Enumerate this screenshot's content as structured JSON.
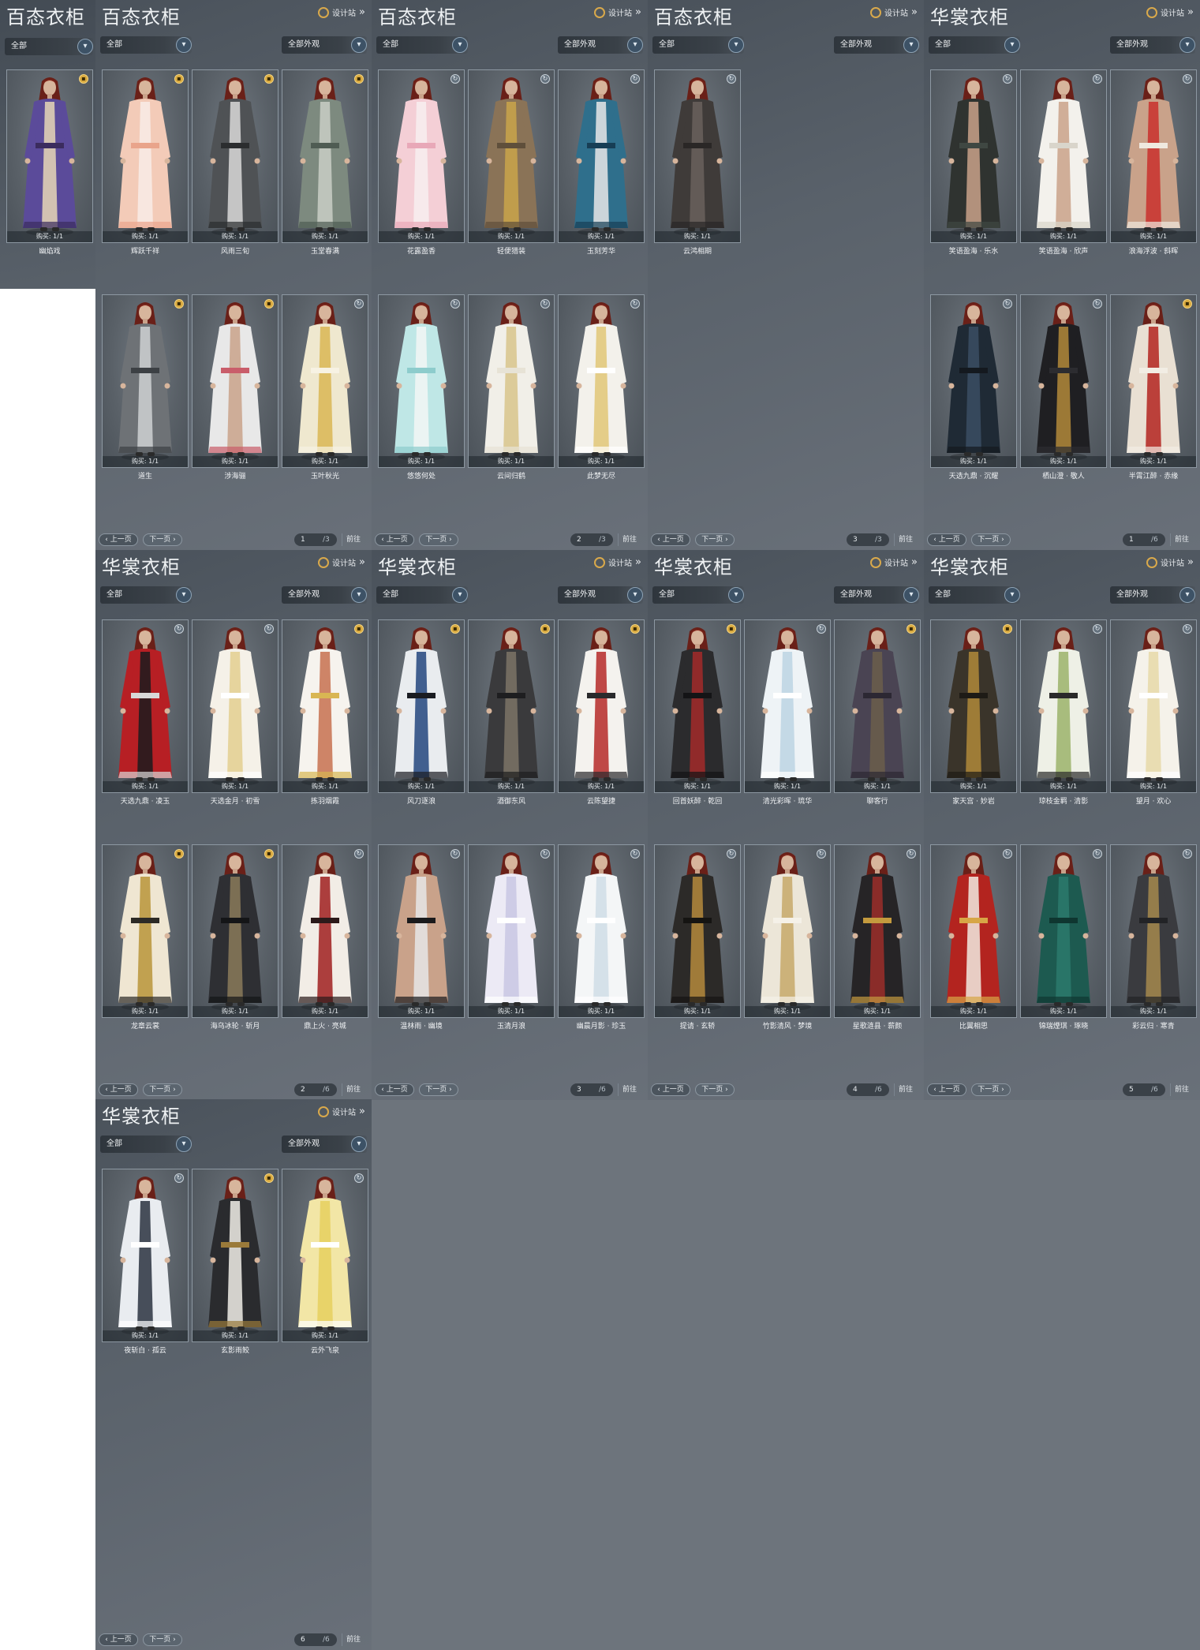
{
  "colors": {
    "panel_bg": "#59616a",
    "card_border": "#8d98a2",
    "badge_gold": "#d8a93f",
    "dropdown_chevron": "#3d5266"
  },
  "icons": {
    "designer": "designer-station-icon",
    "badge_gold": "gold-lock-icon",
    "badge_round": "refresh-icon",
    "chevron": "chevron-down-icon"
  },
  "panels": [
    {
      "title": "百态衣柜",
      "mini": true,
      "filter": "全部",
      "items": [
        {
          "name": "幽焰戏",
          "buy": "购买: 1/1",
          "badge": "gold",
          "skin": [
            "#5b4b9a",
            "#e7d7b6",
            "#3b2c5e"
          ]
        }
      ]
    },
    {
      "title": "百态衣柜",
      "designer": "设计站",
      "filter": "全部",
      "appearance": "全部外观",
      "items": [
        {
          "name": "辉跃千祥",
          "buy": "购买: 1/1",
          "badge": "gold",
          "skin": [
            "#f3cbb8",
            "#f8ece6",
            "#e9a48b"
          ]
        },
        {
          "name": "风雨三旬",
          "buy": "购买: 1/1",
          "badge": "gold",
          "skin": [
            "#4f5255",
            "#d9d9d9",
            "#2b2d2f"
          ]
        },
        {
          "name": "玉堂春满",
          "buy": "购买: 1/1",
          "badge": "gold",
          "skin": [
            "#7d8a7f",
            "#c9cec5",
            "#4f5c53"
          ]
        },
        {
          "name": "道生",
          "buy": "购买: 1/1",
          "badge": "gold",
          "skin": [
            "#6e7276",
            "#cfd1d3",
            "#3c4044"
          ]
        },
        {
          "name": "涉海骊",
          "buy": "购买: 1/1",
          "badge": "gold",
          "skin": [
            "#e8e8e8",
            "#c9a28a",
            "#c95d6a"
          ]
        },
        {
          "name": "玉叶秋光",
          "buy": "购买: 1/1",
          "badge": "round",
          "skin": [
            "#efe8cf",
            "#d9b653",
            "#f7f2e3"
          ]
        }
      ],
      "pager": {
        "prev": "上一页",
        "next": "下一页",
        "page": "1",
        "total": "/3",
        "jump": "前往"
      }
    },
    {
      "title": "百态衣柜",
      "designer": "设计站",
      "filter": "全部",
      "appearance": "全部外观",
      "items": [
        {
          "name": "花露盈香",
          "buy": "购买: 1/1",
          "badge": "round",
          "skin": [
            "#f4cfd6",
            "#f7eef0",
            "#e8a8b8"
          ]
        },
        {
          "name": "轻便猎装",
          "buy": "购买: 1/1",
          "badge": "round",
          "skin": [
            "#8a7357",
            "#c9a54a",
            "#5f4f3b"
          ]
        },
        {
          "name": "玉刻芳华",
          "buy": "购买: 1/1",
          "badge": "round",
          "skin": [
            "#2f6f8c",
            "#e7e7e7",
            "#173e55"
          ]
        },
        {
          "name": "悠悠何处",
          "buy": "购买: 1/1",
          "badge": "round",
          "skin": [
            "#bfe7e6",
            "#f2f6f5",
            "#8dcccc"
          ]
        },
        {
          "name": "云间归鹤",
          "buy": "购买: 1/1",
          "badge": "round",
          "skin": [
            "#f1efe8",
            "#d8c48b",
            "#e7e3d6"
          ]
        },
        {
          "name": "此梦无尽",
          "buy": "购买: 1/1",
          "badge": "round",
          "skin": [
            "#f3f1eb",
            "#e0c777",
            "#ffffff"
          ]
        }
      ],
      "pager": {
        "prev": "上一页",
        "next": "下一页",
        "page": "2",
        "total": "/3",
        "jump": "前往"
      }
    },
    {
      "title": "百态衣柜",
      "designer": "设计站",
      "filter": "全部",
      "appearance": "全部外观",
      "items": [
        {
          "name": "云鸿相期",
          "buy": "购买: 1/1",
          "badge": "round",
          "skin": [
            "#3f3b39",
            "#6a625d",
            "#2a2726"
          ]
        }
      ],
      "pager": {
        "prev": "上一页",
        "next": "下一页",
        "page": "3",
        "total": "/3",
        "jump": "前往"
      }
    },
    {
      "title": "华裳衣柜",
      "designer": "设计站",
      "filter": "全部",
      "appearance": "全部外观",
      "items": [
        {
          "name": "笑语盈海 · 乐水",
          "buy": "购买: 1/1",
          "badge": "round",
          "skin": [
            "#2f3330",
            "#c9a28a",
            "#3f4742"
          ]
        },
        {
          "name": "笑语盈海 · 欣声",
          "buy": "购买: 1/1",
          "badge": "round",
          "skin": [
            "#f3f1ec",
            "#c9a28a",
            "#d9d5cb"
          ]
        },
        {
          "name": "浪海浮波 · 斜晖",
          "buy": "购买: 1/1",
          "badge": "round",
          "skin": [
            "#c9a28a",
            "#c9302c",
            "#efe9df"
          ]
        },
        {
          "name": "天选九鼎 · 沉耀",
          "buy": "购买: 1/1",
          "badge": "round",
          "skin": [
            "#1f2a35",
            "#3b4e63",
            "#14191f"
          ]
        },
        {
          "name": "栖山澄 · 敬人",
          "buy": "购买: 1/1",
          "badge": "round",
          "skin": [
            "#1f1f22",
            "#b38a3a",
            "#2c2c30"
          ]
        },
        {
          "name": "半霄江醉 · 赤缘",
          "buy": "购买: 1/1",
          "badge": "gold",
          "skin": [
            "#e9e0d3",
            "#b3231f",
            "#f2ede4"
          ]
        }
      ],
      "pager": {
        "prev": "上一页",
        "next": "下一页",
        "page": "1",
        "total": "/6",
        "jump": "前往"
      }
    },
    {
      "title": "华裳衣柜",
      "designer": "设计站",
      "filter": "全部",
      "appearance": "全部外观",
      "items": [
        {
          "name": "天选九鼎 · 凌玉",
          "buy": "购买: 1/1",
          "badge": "round",
          "skin": [
            "#b71f24",
            "#1b1b1d",
            "#d8d8d8"
          ]
        },
        {
          "name": "天选金月 · 初雪",
          "buy": "购买: 1/1",
          "badge": "round",
          "skin": [
            "#f5f1e8",
            "#e3cf8f",
            "#ffffff"
          ]
        },
        {
          "name": "拣羽烟霞",
          "buy": "购买: 1/1",
          "badge": "gold",
          "skin": [
            "#f6f3ee",
            "#c7704f",
            "#d9b653"
          ]
        },
        {
          "name": "龙章云裳",
          "buy": "购买: 1/1",
          "badge": "gold",
          "skin": [
            "#efe6d2",
            "#b99439",
            "#2c2a26"
          ]
        },
        {
          "name": "海乌冰轮 · 斩月",
          "buy": "购买: 1/1",
          "badge": "gold",
          "skin": [
            "#2e2f33",
            "#8a7a5a",
            "#141517"
          ]
        },
        {
          "name": "鼎上火 · 亮城",
          "buy": "购买: 1/1",
          "badge": "round",
          "skin": [
            "#f2ede6",
            "#a01f1f",
            "#2b1a1a"
          ]
        }
      ],
      "pager": {
        "prev": "上一页",
        "next": "下一页",
        "page": "2",
        "total": "/6",
        "jump": "前往"
      }
    },
    {
      "title": "华裳衣柜",
      "designer": "设计站",
      "filter": "全部",
      "appearance": "全部外观",
      "items": [
        {
          "name": "风刀逐浪",
          "buy": "购买: 1/1",
          "badge": "gold",
          "skin": [
            "#e9ecef",
            "#23477e",
            "#1a1c22"
          ]
        },
        {
          "name": "酒御东风",
          "buy": "购买: 1/1",
          "badge": "gold",
          "skin": [
            "#3a3a3c",
            "#7c7466",
            "#1e1e20"
          ]
        },
        {
          "name": "云陈望捷",
          "buy": "购买: 1/1",
          "badge": "gold",
          "skin": [
            "#f4f2ee",
            "#b52a28",
            "#2a2a2c"
          ]
        },
        {
          "name": "温林雨 · 幽境",
          "buy": "购买: 1/1",
          "badge": "round",
          "skin": [
            "#c9a28a",
            "#e6e6e6",
            "#1a1a1c"
          ]
        },
        {
          "name": "玉清月浪",
          "buy": "购买: 1/1",
          "badge": "round",
          "skin": [
            "#eceaf5",
            "#c9c7e3",
            "#ffffff"
          ]
        },
        {
          "name": "幽晨月影 · 珍玉",
          "buy": "购买: 1/1",
          "badge": "round",
          "skin": [
            "#f4f6f7",
            "#cfdde6",
            "#ffffff"
          ]
        }
      ],
      "pager": {
        "prev": "上一页",
        "next": "下一页",
        "page": "3",
        "total": "/6",
        "jump": "前往"
      }
    },
    {
      "title": "华裳衣柜",
      "designer": "设计站",
      "filter": "全部",
      "appearance": "全部外观",
      "items": [
        {
          "name": "回首妖醉 · 乾回",
          "buy": "购买: 1/1",
          "badge": "gold",
          "skin": [
            "#2b2b2d",
            "#a32a2a",
            "#141416"
          ]
        },
        {
          "name": "清光彩晖 · 琉华",
          "buy": "购买: 1/1",
          "badge": "round",
          "skin": [
            "#eef3f6",
            "#bcd4e3",
            "#ffffff"
          ]
        },
        {
          "name": "聊客行",
          "buy": "购买: 1/1",
          "badge": "gold",
          "skin": [
            "#4a4453",
            "#6b5e4b",
            "#2c2833"
          ]
        },
        {
          "name": "提请 · 玄轿",
          "buy": "购买: 1/1",
          "badge": "round",
          "skin": [
            "#2c2a28",
            "#b58a3c",
            "#151412"
          ]
        },
        {
          "name": "竹影清风 · 梦境",
          "buy": "购买: 1/1",
          "badge": "round",
          "skin": [
            "#ece6d8",
            "#c7a86a",
            "#f5f1e8"
          ]
        },
        {
          "name": "星歌涟县 · 薪颜",
          "buy": "购买: 1/1",
          "badge": "round",
          "skin": [
            "#262426",
            "#9c2e2a",
            "#c49a3e"
          ]
        }
      ],
      "pager": {
        "prev": "上一页",
        "next": "下一页",
        "page": "4",
        "total": "/6",
        "jump": "前往"
      }
    },
    {
      "title": "华裳衣柜",
      "designer": "设计站",
      "filter": "全部",
      "appearance": "全部外观",
      "items": [
        {
          "name": "家天宫 · 妙岩",
          "buy": "购买: 1/1",
          "badge": "gold",
          "skin": [
            "#3a342a",
            "#b08a3a",
            "#1e1b16"
          ]
        },
        {
          "name": "琼枝金羁 · 清影",
          "buy": "购买: 1/1",
          "badge": "round",
          "skin": [
            "#eef0e6",
            "#9bb36a",
            "#2a2a2a"
          ]
        },
        {
          "name": "望月 · 欢心",
          "buy": "购买: 1/1",
          "badge": "round",
          "skin": [
            "#f5f2ea",
            "#e6d9a8",
            "#ffffff"
          ]
        },
        {
          "name": "比翼相思",
          "buy": "购买: 1/1",
          "badge": "round",
          "skin": [
            "#b3241f",
            "#f1ebe2",
            "#d7a646"
          ]
        },
        {
          "name": "锦瑞煙琪 · 琢晓",
          "buy": "购买: 1/1",
          "badge": "round",
          "skin": [
            "#1d5a50",
            "#2b7a6c",
            "#0f3630"
          ]
        },
        {
          "name": "彩云归 · 寒青",
          "buy": "购买: 1/1",
          "badge": "round",
          "skin": [
            "#3a3b3f",
            "#a68a4e",
            "#222326"
          ]
        }
      ],
      "pager": {
        "prev": "上一页",
        "next": "下一页",
        "page": "5",
        "total": "/6",
        "jump": "前往"
      }
    },
    {
      "title": "华裳衣柜",
      "designer": "设计站",
      "filter": "全部",
      "appearance": "全部外观",
      "items": [
        {
          "name": "夜斩白 · 孤云",
          "buy": "购买: 1/1",
          "badge": "round",
          "skin": [
            "#e9ecf0",
            "#2a3340",
            "#ffffff"
          ]
        },
        {
          "name": "玄影雨鲛",
          "buy": "购买: 1/1",
          "badge": "gold",
          "skin": [
            "#2a2b2e",
            "#f1eee8",
            "#9a7a3a"
          ]
        },
        {
          "name": "云外飞泉",
          "buy": "购买: 1/1",
          "badge": "round",
          "skin": [
            "#f2e6a6",
            "#e6cf5e",
            "#ffffff"
          ]
        }
      ],
      "pager": {
        "prev": "上一页",
        "next": "下一页",
        "page": "6",
        "total": "/6",
        "jump": "前往"
      }
    }
  ]
}
